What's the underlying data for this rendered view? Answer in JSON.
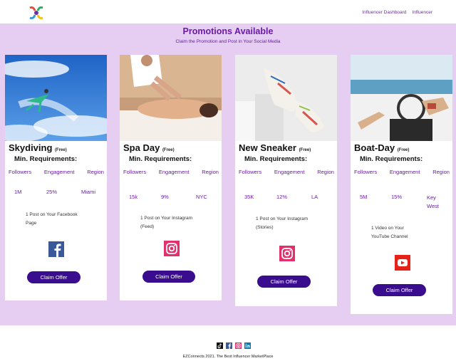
{
  "nav": {
    "dashboard": "Influencer Dashboard",
    "influencer": "Influencer"
  },
  "header": {
    "title": "Promotions Available",
    "subtitle": "Claim the Promotion and Post in Your Social Media"
  },
  "requirements_label": "Min. Requirements:",
  "columns": {
    "followers": "Followers",
    "engagement": "Engagement",
    "region": "Region"
  },
  "free_label": "(Free)",
  "claim_label": "Claim Offer",
  "cards": [
    {
      "title": "Skydiving",
      "followers": "1M",
      "engagement": "25%",
      "region": "Miami",
      "post_line1": "1 Post on Your Facebook",
      "post_line2": "Page",
      "social_icon": "facebook-icon"
    },
    {
      "title": "Spa Day",
      "followers": "15k",
      "engagement": "9%",
      "region": "NYC",
      "post_line1": "1 Post on Your Instagram",
      "post_line2": "(Feed)",
      "social_icon": "instagram-icon"
    },
    {
      "title": "New Sneaker",
      "followers": "35K",
      "engagement": "12%",
      "region": "LA",
      "post_line1": "1 Post on Your Instagram",
      "post_line2": "(Stories)",
      "social_icon": "instagram-icon"
    },
    {
      "title": "Boat-Day",
      "followers": "5M",
      "engagement": "15%",
      "region": "Key",
      "region2": "West",
      "post_line1": "1 Video on Your",
      "post_line2": "YouTube Channel",
      "social_icon": "youtube-icon"
    }
  ],
  "footer": {
    "text": "EZConnects 2021. The Best Influencer MarketPlace"
  },
  "colors": {
    "band": "#e5cef1",
    "accent": "#6a1aa8",
    "button": "#3a0c8e"
  }
}
